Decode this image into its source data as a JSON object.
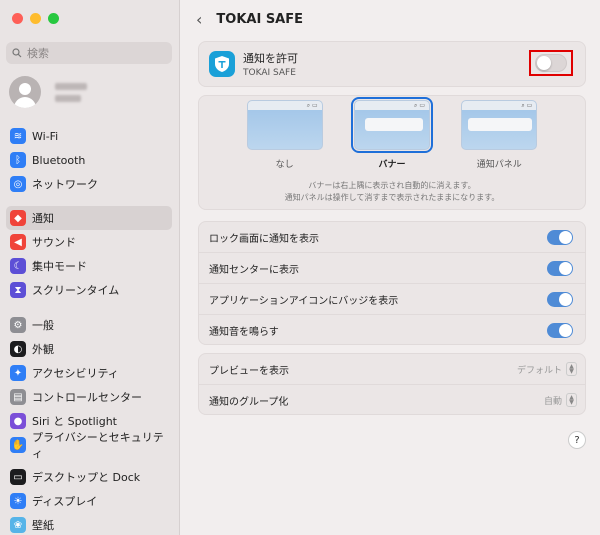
{
  "sidebar": {
    "search_placeholder": "検索",
    "groups": [
      [
        {
          "label": "Wi-Fi",
          "icon": "wifi-icon",
          "color": "#2f7ef6"
        },
        {
          "label": "Bluetooth",
          "icon": "bluetooth-icon",
          "color": "#2f7ef6"
        },
        {
          "label": "ネットワーク",
          "icon": "globe-icon",
          "color": "#2f7ef6"
        }
      ],
      [
        {
          "label": "通知",
          "icon": "bell-icon",
          "color": "#f0443a",
          "active": true
        },
        {
          "label": "サウンド",
          "icon": "speaker-icon",
          "color": "#f0443a"
        },
        {
          "label": "集中モード",
          "icon": "moon-icon",
          "color": "#5d4fd6"
        },
        {
          "label": "スクリーンタイム",
          "icon": "hourglass-icon",
          "color": "#5d4fd6"
        }
      ],
      [
        {
          "label": "一般",
          "icon": "gear-icon",
          "color": "#8e8e93"
        },
        {
          "label": "外観",
          "icon": "appearance-icon",
          "color": "#1c1c1e"
        },
        {
          "label": "アクセシビリティ",
          "icon": "accessibility-icon",
          "color": "#2f7ef6"
        },
        {
          "label": "コントロールセンター",
          "icon": "control-center-icon",
          "color": "#8e8e93"
        },
        {
          "label": "Siri と Spotlight",
          "icon": "siri-icon",
          "color": "#7b4fd8"
        },
        {
          "label": "プライバシーとセキュリティ",
          "icon": "hand-icon",
          "color": "#2f7ef6"
        }
      ],
      [
        {
          "label": "デスクトップと Dock",
          "icon": "dock-icon",
          "color": "#1c1c1e"
        },
        {
          "label": "ディスプレイ",
          "icon": "sun-icon",
          "color": "#2f7ef6"
        },
        {
          "label": "壁紙",
          "icon": "wallpaper-icon",
          "color": "#56b4e8"
        }
      ]
    ]
  },
  "header": {
    "title": "TOKAI SAFE"
  },
  "allow": {
    "label": "通知を許可",
    "app_name": "TOKAI SAFE",
    "enabled": false
  },
  "styles": {
    "options": [
      "なし",
      "バナー",
      "通知パネル"
    ],
    "selected": "バナー",
    "description_line1": "バナーは右上隅に表示され自動的に消えます。",
    "description_line2": "通知パネルは操作して消すまで表示されたままになります。"
  },
  "options": [
    {
      "label": "ロック画面に通知を表示",
      "enabled": true
    },
    {
      "label": "通知センターに表示",
      "enabled": true
    },
    {
      "label": "アプリケーションアイコンにバッジを表示",
      "enabled": true
    },
    {
      "label": "通知音を鳴らす",
      "enabled": true
    }
  ],
  "selects": [
    {
      "label": "プレビューを表示",
      "value": "デフォルト"
    },
    {
      "label": "通知のグループ化",
      "value": "自動"
    }
  ],
  "help_label": "?",
  "colors": {
    "accent": "#1e6fd9",
    "toggle_on": "#4f8bd6",
    "highlight": "#e00000"
  }
}
